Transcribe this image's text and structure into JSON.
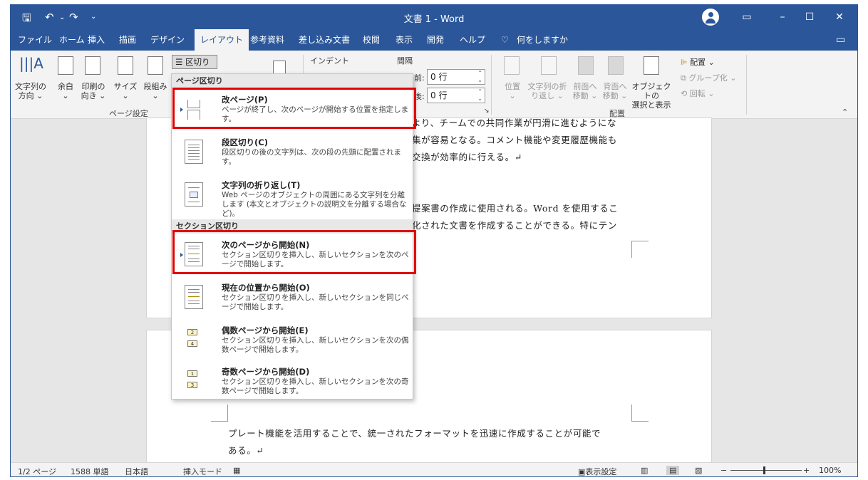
{
  "window": {
    "title": "文書 1 - Word"
  },
  "tabs": [
    {
      "label": "ファイル"
    },
    {
      "label": "ホーム"
    },
    {
      "label": "挿入"
    },
    {
      "label": "描画"
    },
    {
      "label": "デザイン"
    },
    {
      "label": "レイアウト"
    },
    {
      "label": "参考資料"
    },
    {
      "label": "差し込み文書"
    },
    {
      "label": "校閲"
    },
    {
      "label": "表示"
    },
    {
      "label": "開発"
    },
    {
      "label": "ヘルプ"
    },
    {
      "label": "何をしますか"
    }
  ],
  "ribbon": {
    "text_direction": "文字列の\n方向 ⌄",
    "margins": "余白\n⌄",
    "orientation": "印刷の\n向き ⌄",
    "size": "サイズ\n⌄",
    "columns": "段組み\n⌄",
    "breaks_button": "区切り ⌄",
    "page_setup_group": "ページ設定",
    "indent_label": "インデント",
    "spacing_label": "間隔",
    "before_label": "前:",
    "before_value": "0 行",
    "after_label": "後:",
    "after_value": "0 行",
    "position": "位置\n⌄",
    "wrap_text": "文字列の折\nり返し ⌄",
    "bring_forward": "前面へ\n移動 ⌄",
    "send_backward": "背面へ\n移動 ⌄",
    "selection_pane": "オブジェクトの\n選択と表示",
    "align": "配置 ⌄",
    "group": "グループ化 ⌄",
    "rotate": "回転 ⌄",
    "arrange_group": "配置"
  },
  "breaks_menu": {
    "page_breaks_header": "ページ区切り",
    "section_breaks_header": "セクション区切り",
    "items": [
      {
        "title": "改ページ(P)",
        "desc": "ページが終了し、次のページが開始する位置を指定します。"
      },
      {
        "title": "段区切り(C)",
        "desc": "段区切りの後の文字列は、次の段の先頭に配置されます。"
      },
      {
        "title": "文字列の折り返し(T)",
        "desc": "Web ページのオブジェクトの周囲にある文字列を分離します (本文とオブジェクトの説明文を分離する場合など)。"
      },
      {
        "title": "次のページから開始(N)",
        "desc": "セクション区切りを挿入し、新しいセクションを次のページで開始します。"
      },
      {
        "title": "現在の位置から開始(O)",
        "desc": "セクション区切りを挿入し、新しいセクションを同じページで開始します。"
      },
      {
        "title": "偶数ページから開始(E)",
        "desc": "セクション区切りを挿入し、新しいセクションを次の偶数ページで開始します。"
      },
      {
        "title": "奇数ページから開始(D)",
        "desc": "セクション区切りを挿入し、新しいセクションを次の奇数ページで開始します。"
      }
    ]
  },
  "document": {
    "p1_line1": "より、チームでの共同作業が円滑に進むようにな",
    "p1_line2": "集が容易となる。コメント機能や変更履歴機能も",
    "p1_line3": "交換が効率的に行える。↵",
    "p2_line1": "提案書の作成に使用される。Word を使用するこ",
    "p2_line2": "化された文書を作成することができる。特にテン",
    "p3_line1": "プレート機能を活用することで、統一されたフォーマットを迅速に作成することが可能で",
    "p3_line2": "ある。↵"
  },
  "statusbar": {
    "page": "1/2 ページ",
    "words": "1588 単語",
    "language": "日本語",
    "mode": "挿入モード",
    "display_settings": "表示設定",
    "zoom": "100%"
  },
  "colors": {
    "accent": "#2b579a",
    "highlight": "#e00000"
  }
}
